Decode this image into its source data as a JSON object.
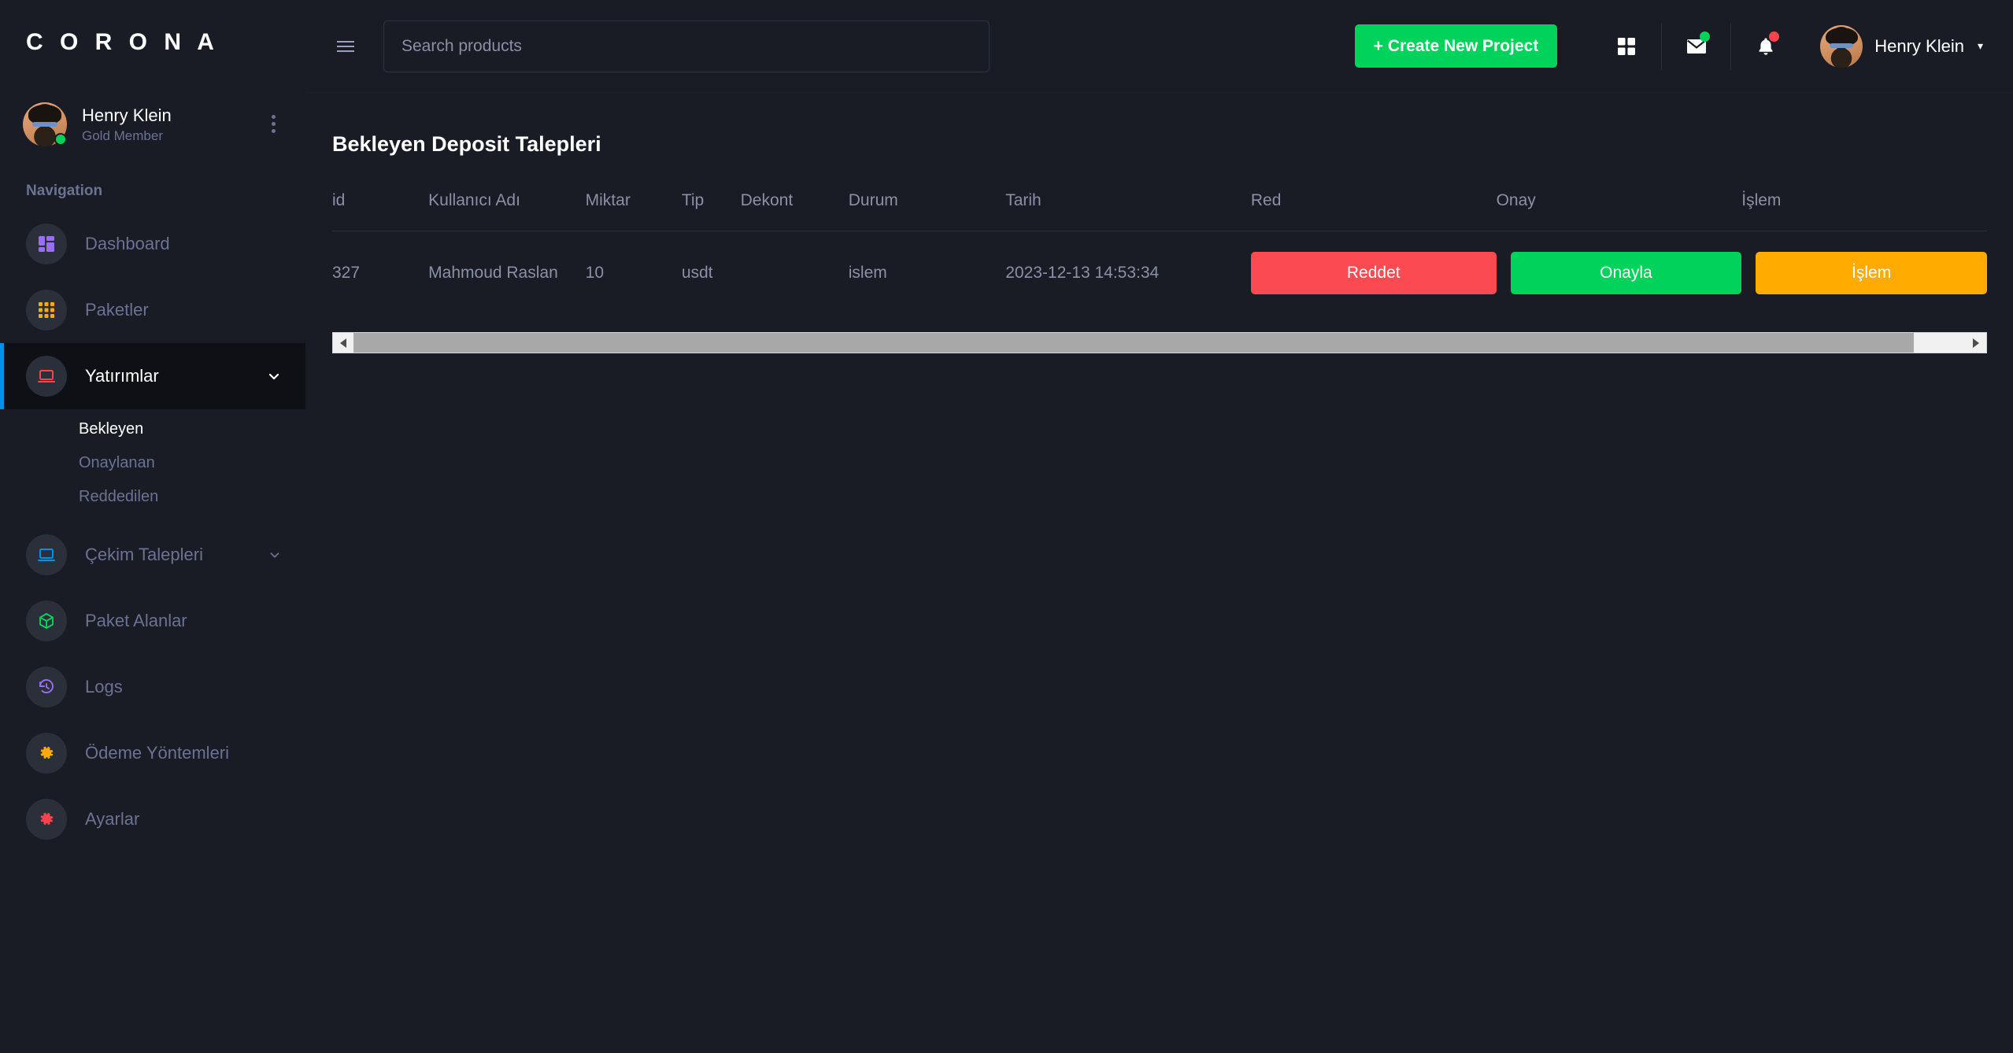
{
  "brand": {
    "name": "C O R O N A"
  },
  "sidebar": {
    "profile": {
      "name": "Henry Klein",
      "role": "Gold Member"
    },
    "category_label": "Navigation",
    "items": [
      {
        "label": "Dashboard",
        "icon": "dashboard-grid-icon",
        "color": "#8f5fe8"
      },
      {
        "label": "Paketler",
        "icon": "apps-grid-icon",
        "color": "#ffab00"
      },
      {
        "label": "Yatırımlar",
        "icon": "laptop-icon",
        "color": "#fc424a"
      },
      {
        "label": "Çekim Talepleri",
        "icon": "laptop-icon",
        "color": "#0090e7"
      },
      {
        "label": "Paket Alanlar",
        "icon": "box-icon",
        "color": "#00d25b"
      },
      {
        "label": "Logs",
        "icon": "history-icon",
        "color": "#8f5fe8"
      },
      {
        "label": "Ödeme Yöntemleri",
        "icon": "gear-icon",
        "color": "#ffab00"
      },
      {
        "label": "Ayarlar",
        "icon": "gear-icon",
        "color": "#fc424a"
      }
    ],
    "submenu": [
      {
        "label": "Bekleyen"
      },
      {
        "label": "Onaylanan"
      },
      {
        "label": "Reddedilen"
      }
    ]
  },
  "topbar": {
    "search_placeholder": "Search products",
    "search_value": "",
    "create_button": "+ Create New Project",
    "user_name": "Henry Klein",
    "caret": "▾",
    "icons": [
      "apps-grid-icon",
      "mail-icon",
      "bell-icon"
    ]
  },
  "content": {
    "page_title": "Bekleyen Deposit Talepleri",
    "columns": [
      "id",
      "Kullanıcı Adı",
      "Miktar",
      "Tip",
      "Dekont",
      "Durum",
      "Tarih",
      "Red",
      "Onay",
      "İşlem"
    ],
    "rows": [
      {
        "id": "327",
        "username": "Mahmoud Raslan",
        "amount": "10",
        "type": "usdt",
        "receipt": "",
        "status": "islem",
        "date": "2023-12-13 14:53:34",
        "reject_label": "Reddet",
        "approve_label": "Onayla",
        "process_label": "İşlem"
      }
    ]
  },
  "colors": {
    "background": "#191c24",
    "active_accent": "#0090e7",
    "reject": "#fc4a52",
    "approve": "#00d25b",
    "process": "#ffab00"
  }
}
